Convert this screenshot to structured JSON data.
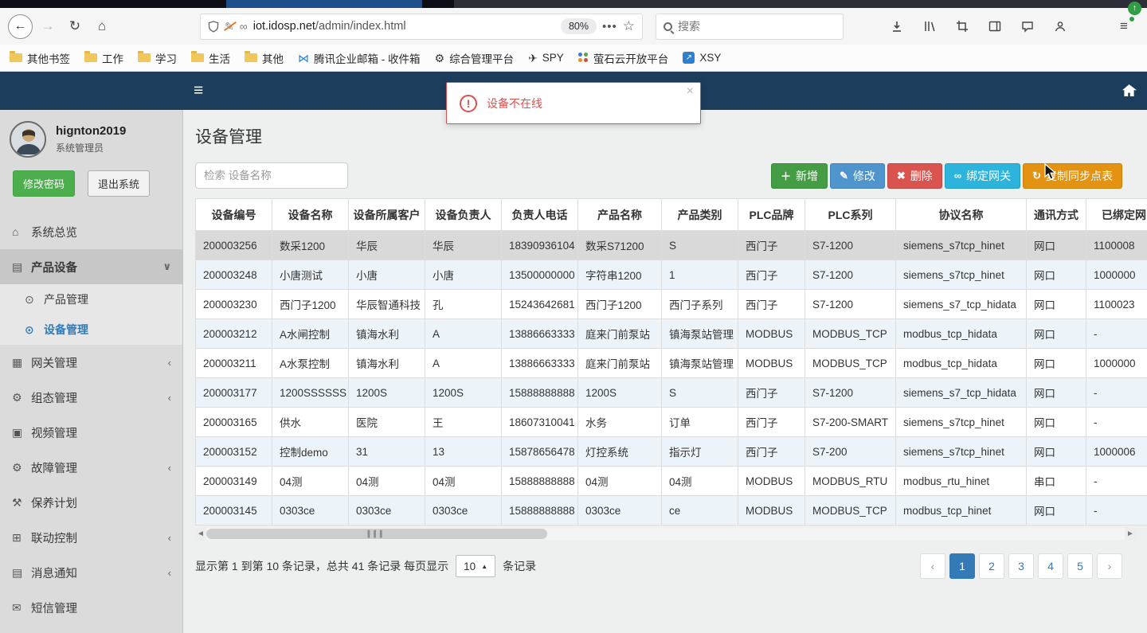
{
  "browser_top": {
    "url_domain": "iot.idosp.net",
    "url_path": "/admin/index.html",
    "zoom_badge": "80%",
    "search_placeholder": "搜索",
    "bookmarks": [
      {
        "label": "其他书签",
        "icon": "folder-icon"
      },
      {
        "label": "工作",
        "icon": "folder-icon"
      },
      {
        "label": "学习",
        "icon": "folder-icon"
      },
      {
        "label": "生活",
        "icon": "folder-icon"
      },
      {
        "label": "其他",
        "icon": "folder-icon"
      },
      {
        "label": "腾讯企业邮箱 - 收件箱",
        "icon": "mail-icon"
      },
      {
        "label": "综合管理平台",
        "icon": "gear-icon"
      },
      {
        "label": "SPY",
        "icon": "plane-icon"
      },
      {
        "label": "萤石云开放平台",
        "icon": "dots-icon"
      },
      {
        "label": "XSY",
        "icon": "app-icon"
      }
    ]
  },
  "alert": {
    "message": "设备不在线",
    "close_label": "×"
  },
  "sidebar": {
    "username": "hignton2019",
    "role": "系统管理员",
    "change_password_label": "修改密码",
    "logout_label": "退出系统",
    "menu": [
      {
        "label": "系统总览",
        "icon": "home-icon"
      },
      {
        "label": "产品设备",
        "icon": "book-icon",
        "chevron": "down",
        "active": true,
        "children": [
          {
            "label": "产品管理",
            "icon": "target-icon"
          },
          {
            "label": "设备管理",
            "icon": "target-icon",
            "active": true
          }
        ]
      },
      {
        "label": "网关管理",
        "icon": "grid-icon",
        "chevron": "left"
      },
      {
        "label": "组态管理",
        "icon": "cogs-icon",
        "chevron": "left"
      },
      {
        "label": "视频管理",
        "icon": "monitor-icon"
      },
      {
        "label": "故障管理",
        "icon": "cogs-icon",
        "chevron": "left"
      },
      {
        "label": "保养计划",
        "icon": "wrench-icon"
      },
      {
        "label": "联动控制",
        "icon": "sitemap-icon",
        "chevron": "left"
      },
      {
        "label": "消息通知",
        "icon": "book-icon",
        "chevron": "left"
      },
      {
        "label": "短信管理",
        "icon": "envelope-icon"
      }
    ]
  },
  "main": {
    "title": "设备管理",
    "search_placeholder": "检索 设备名称",
    "toolbar": [
      {
        "label": "新增",
        "icon": "plus-icon",
        "color": "#449d44"
      },
      {
        "label": "修改",
        "icon": "pencil-icon",
        "color": "#5094ce"
      },
      {
        "label": "删除",
        "icon": "x-icon",
        "color": "#d9534f"
      },
      {
        "label": "绑定网关",
        "icon": "link-icon",
        "color": "#2db4dc"
      },
      {
        "label": "复制同步点表",
        "icon": "sync-icon",
        "color": "#e39211"
      }
    ],
    "table": {
      "columns": [
        "设备编号",
        "设备名称",
        "设备所属客户",
        "设备负责人",
        "负责人电话",
        "产品名称",
        "产品类别",
        "PLC品牌",
        "PLC系列",
        "协议名称",
        "通讯方式",
        "已绑定网"
      ],
      "rows": [
        [
          "200003256",
          "数采1200",
          "华辰",
          "华辰",
          "18390936104",
          "数采S71200",
          "S",
          "西门子",
          "S7-1200",
          "siemens_s7tcp_hinet",
          "网口",
          "1100008"
        ],
        [
          "200003248",
          "小唐测试",
          "小唐",
          "小唐",
          "13500000000",
          "字符串1200",
          "1",
          "西门子",
          "S7-1200",
          "siemens_s7tcp_hinet",
          "网口",
          "1000000"
        ],
        [
          "200003230",
          "西门子1200",
          "华辰智通科技",
          "孔",
          "15243642681",
          "西门子1200",
          "西门子系列",
          "西门子",
          "S7-1200",
          "siemens_s7_tcp_hidata",
          "网口",
          "1100023"
        ],
        [
          "200003212",
          "A水闸控制",
          "镇海水利",
          "A",
          "13886663333",
          "庭来门前泵站",
          "镇海泵站管理",
          "MODBUS",
          "MODBUS_TCP",
          "modbus_tcp_hidata",
          "网口",
          "-"
        ],
        [
          "200003211",
          "A水泵控制",
          "镇海水利",
          "A",
          "13886663333",
          "庭来门前泵站",
          "镇海泵站管理",
          "MODBUS",
          "MODBUS_TCP",
          "modbus_tcp_hidata",
          "网口",
          "1000000"
        ],
        [
          "200003177",
          "1200SSSSSS",
          "1200S",
          "1200S",
          "15888888888",
          "1200S",
          "S",
          "西门子",
          "S7-1200",
          "siemens_s7_tcp_hidata",
          "网口",
          "-"
        ],
        [
          "200003165",
          "供水",
          "医院",
          "王",
          "18607310041",
          "水务",
          "订单",
          "西门子",
          "S7-200-SMART",
          "siemens_s7tcp_hinet",
          "网口",
          "-"
        ],
        [
          "200003152",
          "控制demo",
          "31",
          "13",
          "15878656478",
          "灯控系统",
          "指示灯",
          "西门子",
          "S7-200",
          "siemens_s7tcp_hinet",
          "网口",
          "1000006"
        ],
        [
          "200003149",
          "04测",
          "04测",
          "04测",
          "15888888888",
          "04测",
          "04测",
          "MODBUS",
          "MODBUS_RTU",
          "modbus_rtu_hinet",
          "串口",
          "-"
        ],
        [
          "200003145",
          "0303ce",
          "0303ce",
          "0303ce",
          "15888888888",
          "0303ce",
          "ce",
          "MODBUS",
          "MODBUS_TCP",
          "modbus_tcp_hinet",
          "网口",
          "-"
        ]
      ],
      "selected_row": 0
    },
    "pagination": {
      "summary_before": "显示第 1 到第 10 条记录，总共 41 条记录 每页显示",
      "page_size": "10",
      "summary_after": "条记录",
      "prev": "‹",
      "next": "›",
      "pages": [
        "1",
        "2",
        "3",
        "4",
        "5"
      ],
      "active_page": "1"
    }
  }
}
